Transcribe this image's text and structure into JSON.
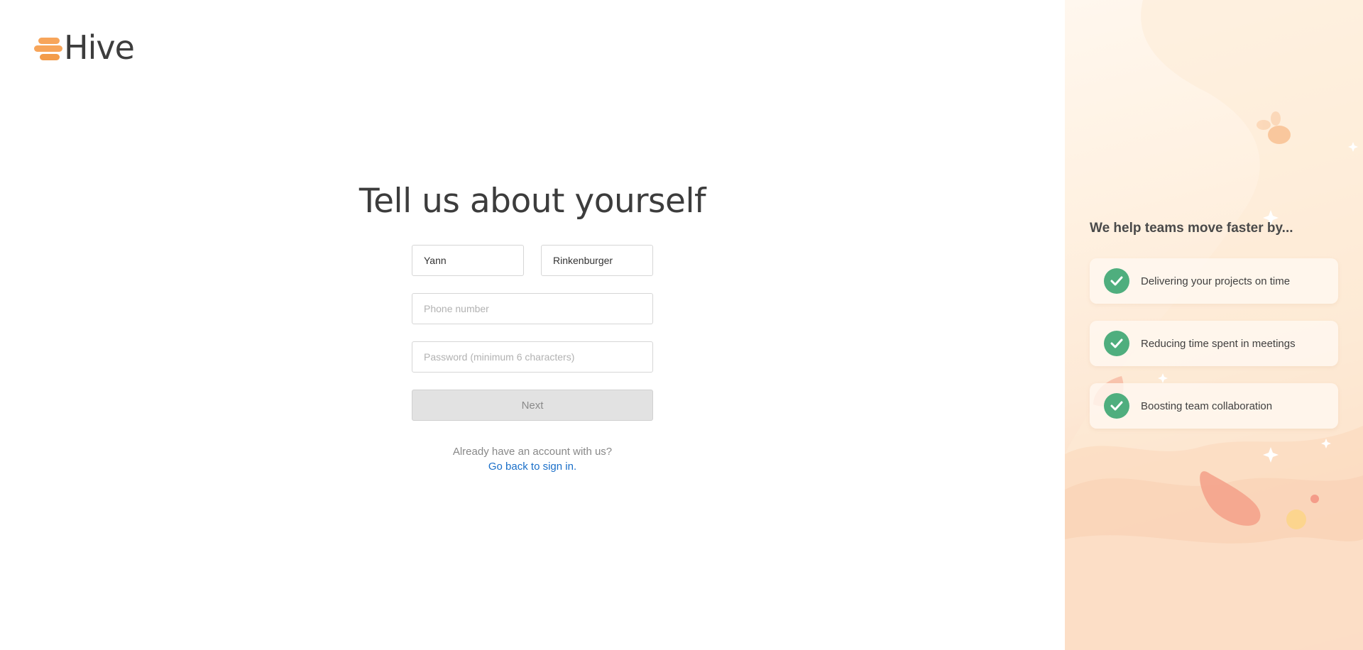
{
  "brand": {
    "name": "Hive"
  },
  "form": {
    "title": "Tell us about yourself",
    "first_name_value": "Yann",
    "last_name_value": "Rinkenburger",
    "phone_placeholder": "Phone number",
    "password_placeholder": "Password (minimum 6 characters)",
    "next_label": "Next",
    "account_prompt": "Already have an account with us?",
    "signin_link": "Go back to sign in."
  },
  "panel": {
    "title": "We help teams move faster by...",
    "benefits": [
      {
        "label": "Delivering your projects on time",
        "icon": "check-circle-icon"
      },
      {
        "label": "Reducing time spent in meetings",
        "icon": "check-circle-icon"
      },
      {
        "label": "Boosting team collaboration",
        "icon": "check-circle-icon"
      }
    ]
  },
  "colors": {
    "brand_orange": "#f7a55a",
    "check_green": "#4fae7e",
    "link_blue": "#1a6fc9",
    "disabled_button": "#e2e2e2"
  }
}
